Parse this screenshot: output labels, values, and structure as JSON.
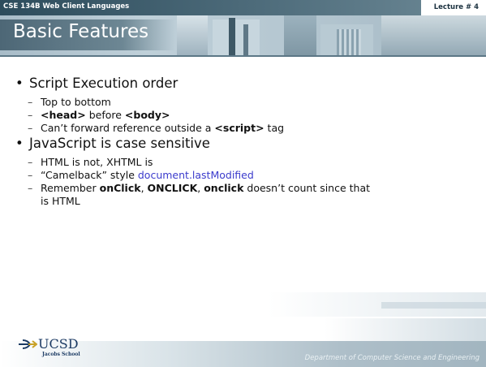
{
  "header": {
    "course": "CSE 134B  Web Client Languages",
    "lecture": "Lecture # 4",
    "title": "Basic Features"
  },
  "bullets": [
    {
      "text": "Script Execution order",
      "subitems": [
        {
          "parts": [
            "Top to bottom"
          ]
        },
        {
          "parts": [
            "<head>",
            " before ",
            "<body>"
          ]
        },
        {
          "parts": [
            "Can’t forward reference outside a ",
            "<script>",
            " tag"
          ]
        }
      ]
    },
    {
      "text": "JavaScript is case sensitive",
      "subitems": [
        {
          "parts": [
            "HTML is not, XHTML is"
          ]
        },
        {
          "parts": [
            "“Camelback” style ",
            "document.lastModified"
          ]
        },
        {
          "parts": [
            "Remember ",
            "onClick",
            ", ",
            "ONCLICK",
            ", ",
            "onclick",
            " doesn’t count since that",
            "is HTML"
          ]
        }
      ]
    }
  ],
  "footer": {
    "logo_text": "UCSD",
    "logo_sub": "Jacobs School",
    "department": "Department of Computer Science and Engineering"
  },
  "colors": {
    "link": "#3b3bcc",
    "header_dark": "#2d4c5c",
    "logo_blue": "#1b3a63"
  },
  "icons": {
    "bullet": "bullet-dot",
    "sub_bullet": "dash",
    "logo": "trident-logo-icon"
  }
}
